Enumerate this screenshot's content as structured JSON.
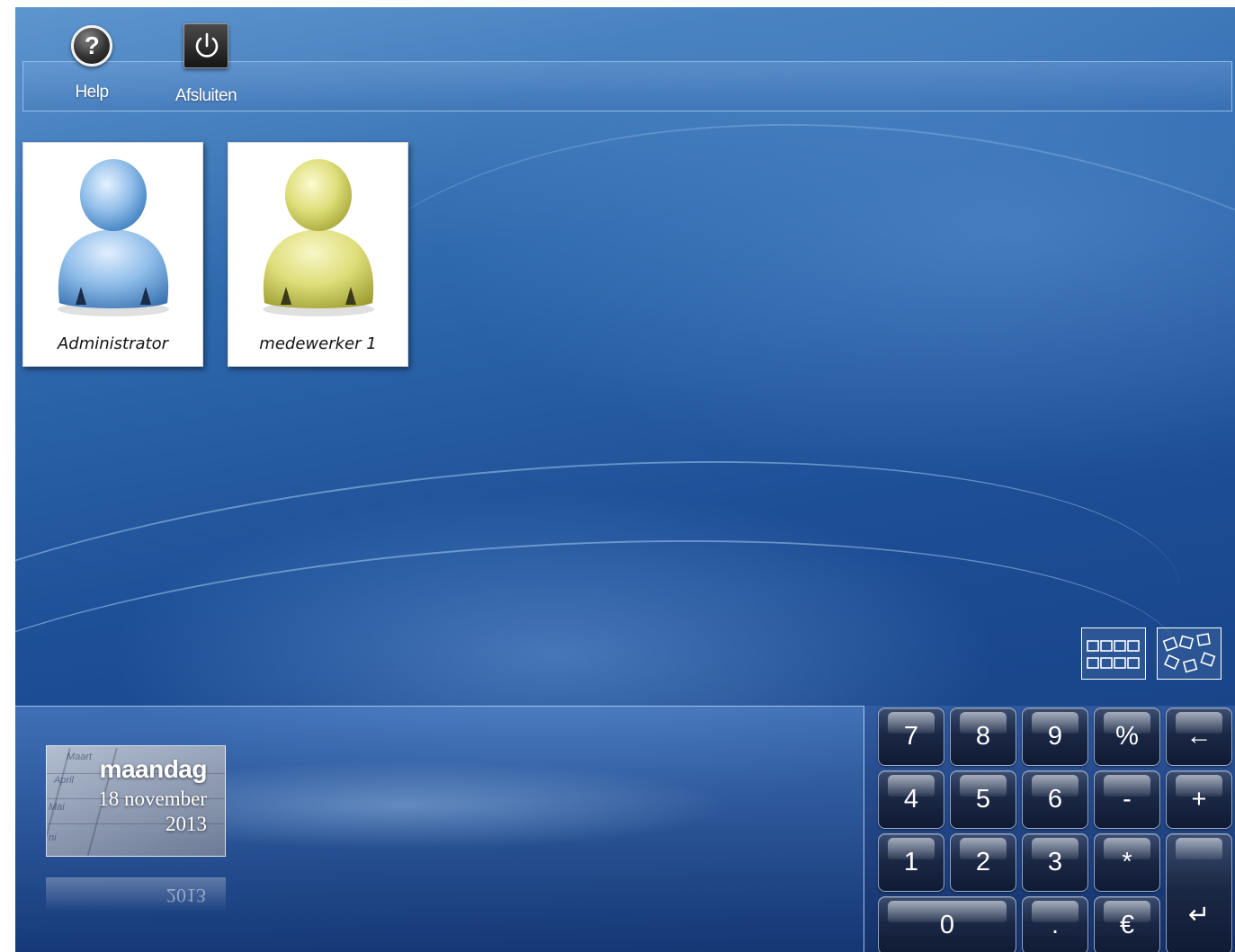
{
  "toolbar": {
    "help_label": "Help",
    "shutdown_label": "Afsluiten"
  },
  "users": [
    {
      "name": "Administrator",
      "avatar_color": "#8fbde9",
      "icon": "user-blue-icon"
    },
    {
      "name": "medewerker 1",
      "avatar_color": "#dede7a",
      "icon": "user-yellow-icon"
    }
  ],
  "view_toggle": {
    "grid_icon": "grid-view-icon",
    "scatter_icon": "scattered-view-icon"
  },
  "date_panel": {
    "weekday": "maandag",
    "date": "18 november",
    "year": "2013",
    "calendar_months": [
      "Maart",
      "April",
      "Mai",
      "ni"
    ]
  },
  "numpad": {
    "keys": [
      "7",
      "8",
      "9",
      "%",
      "←",
      "4",
      "5",
      "6",
      "-",
      "+",
      "1",
      "2",
      "3",
      "*",
      "↵",
      "0",
      ".",
      "€"
    ]
  },
  "colors": {
    "background": "#1d4f97",
    "key": "#1b2845",
    "tile": "#ffffff"
  }
}
